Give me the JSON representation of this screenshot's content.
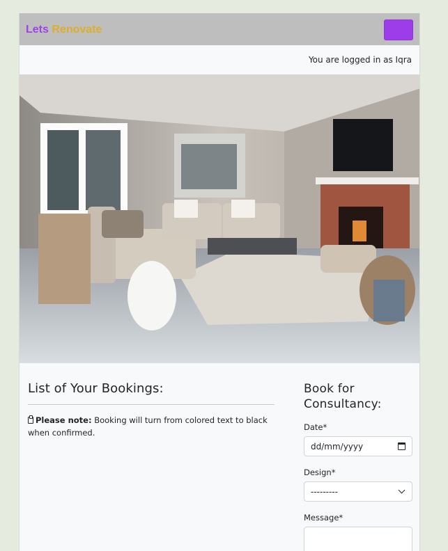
{
  "brand": {
    "part1": "Lets",
    "part2": "Renovate"
  },
  "status": {
    "logged_in_text": "You are logged in as Iqra"
  },
  "bookings": {
    "title": "List of Your Bookings:",
    "note_label": "Please note:",
    "note_text": " Booking will turn from colored text to black when confirmed."
  },
  "form": {
    "title": "Book for Consultancy:",
    "date_label": "Date*",
    "date_value": "dd/mm/yyyy",
    "design_label": "Design*",
    "design_value": "---------",
    "message_label": "Message*"
  },
  "colors": {
    "brand_purple": "#9b44e4",
    "brand_gold": "#ddae2b",
    "toggle": "#9d3ce9"
  },
  "icons": {
    "note": "clipboard-icon",
    "date": "calendar-icon",
    "select": "chevron-down-icon"
  }
}
